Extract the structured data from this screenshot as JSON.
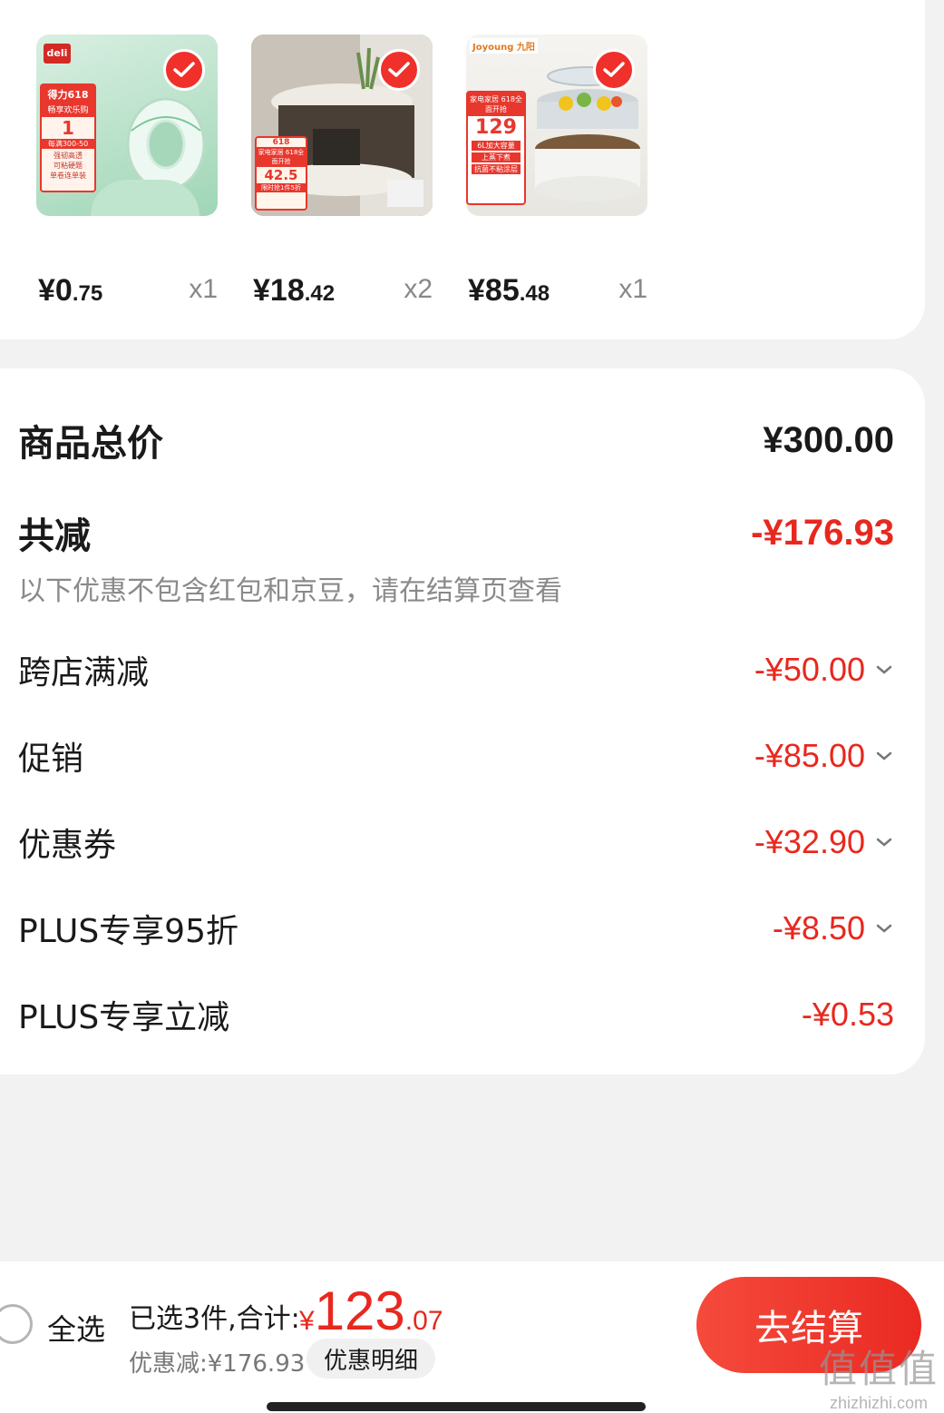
{
  "products": [
    {
      "price_int": "¥0",
      "price_dec": ".75",
      "qty": "x1",
      "thumb_text": {
        "brand": "deli",
        "promo1": "得力618",
        "promo2": "畅享欢乐购",
        "num": "1",
        "line1": "每满300-50",
        "line2": "强韧高透",
        "line3": "可粘硬题",
        "line4": "单卷连单装"
      }
    },
    {
      "price_int": "¥18",
      "price_dec": ".42",
      "qty": "x2",
      "thumb_text": {
        "tag": "618",
        "promo": "家电家居 618全面开抢",
        "price": "42.5",
        "line1": "限时抢1件5折"
      }
    },
    {
      "price_int": "¥85",
      "price_dec": ".48",
      "qty": "x1",
      "thumb_text": {
        "brand": "Joyoung 九阳",
        "promo": "家电家居 618全面开抢",
        "price": "129",
        "line1": "6L加大容量",
        "line2": "上蒸下煮",
        "line3": "抗菌不粘涂层"
      }
    }
  ],
  "summary": {
    "total_label": "商品总价",
    "total_value": "¥300.00",
    "reduce_label": "共减",
    "reduce_value": "-¥176.93",
    "note": "以下优惠不包含红包和京豆，请在结算页查看",
    "items": [
      {
        "label": "跨店满减",
        "value": "-¥50.00"
      },
      {
        "label": "促销",
        "value": "-¥85.00"
      },
      {
        "label": "优惠券",
        "value": "-¥32.90"
      },
      {
        "label": "PLUS专享95折",
        "value": "-¥8.50"
      },
      {
        "label": "PLUS专享立减",
        "value": "-¥0.53"
      }
    ]
  },
  "bottom": {
    "select_all": "全选",
    "selected_info": "已选3件,合计:",
    "total_sym": "¥",
    "total_int": "123",
    "total_dec": ".07",
    "discount_info": "优惠减:¥176.93",
    "detail_button": "优惠明细",
    "checkout_button": "去结算"
  },
  "watermark": {
    "big": "值值值",
    "small": "zhizhizhi.com"
  },
  "colors": {
    "accent": "#e8281e",
    "checkout": "#ea2a22",
    "background": "#f2f2f2"
  }
}
